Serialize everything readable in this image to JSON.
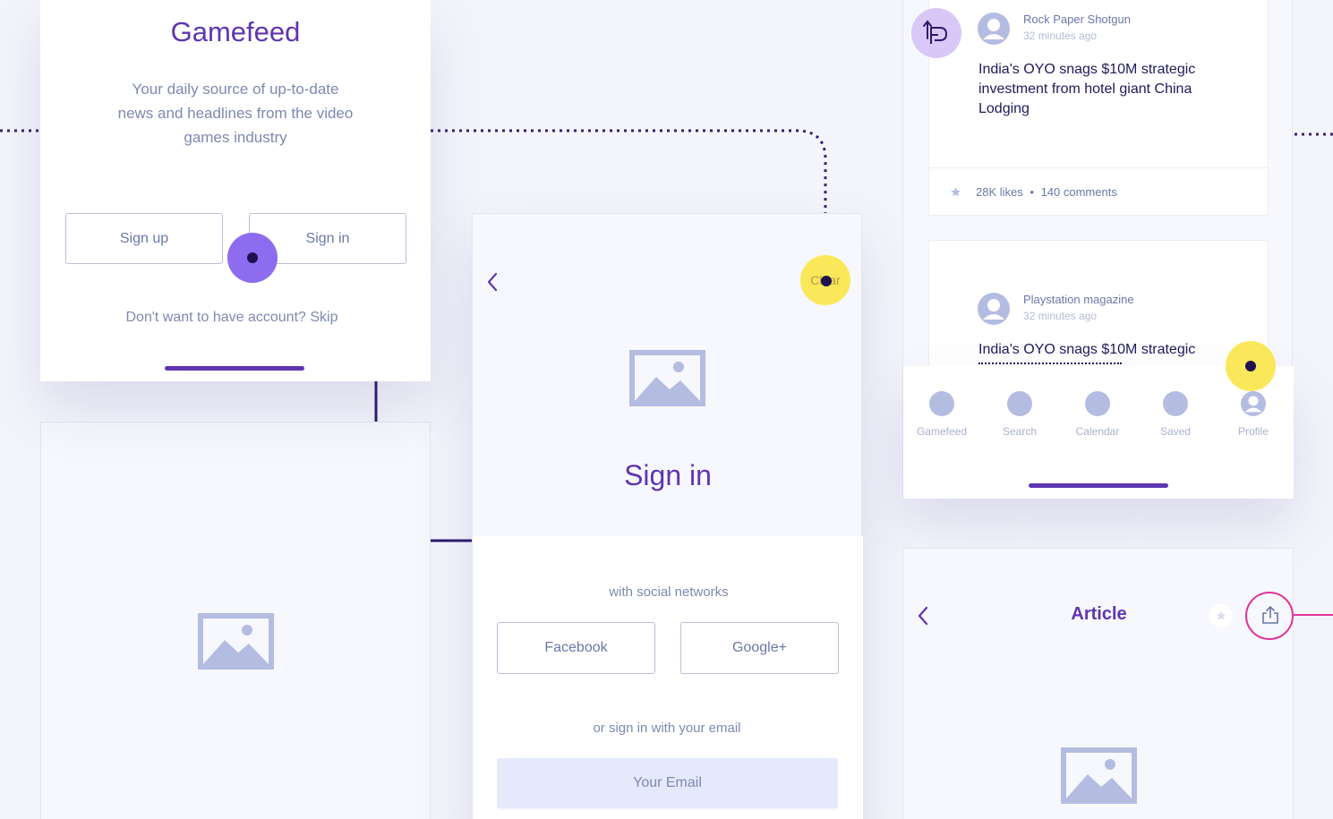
{
  "welcome": {
    "app_title": "Gamefeed",
    "tagline_line1": "Your daily source of up-to-date",
    "tagline_line2": "news and headlines from the video",
    "tagline_line3": "games industry",
    "signup_label": "Sign up",
    "signin_label": "Sign in",
    "skip_text": "Don't want to have account? Skip"
  },
  "signin": {
    "clear_label": "Clear",
    "title": "Sign in",
    "social_caption": "with social networks",
    "facebook_label": "Facebook",
    "google_label": "Google+",
    "email_caption": "or sign in with your email",
    "email_placeholder": "Your Email"
  },
  "feed": {
    "posts": [
      {
        "source": "Rock Paper Shotgun",
        "time": "32 minutes ago",
        "headline_line1": "India's OYO snags $10M strategic",
        "headline_line2": "investment from hotel giant China",
        "headline_line3": "Lodging",
        "likes": "28K likes",
        "separator": "•",
        "comments": "140 comments"
      },
      {
        "source": "Playstation magazine",
        "time": "32 minutes ago",
        "headline_line1": "India's OYO snags $10M strategic"
      }
    ],
    "nav": [
      "Gamefeed",
      "Search",
      "Calendar",
      "Saved",
      "Profile"
    ]
  },
  "article": {
    "title": "Article"
  },
  "colors": {
    "brand_purple": "#5e35b1",
    "accent_violet": "#8e6cf0",
    "hotspot_yellow": "#fbe85a",
    "share_pink": "#e0349c",
    "placeholder": "#b4bce2"
  },
  "icons": [
    "chevron-left-icon",
    "image-placeholder-icon",
    "avatar-icon",
    "star-icon",
    "share-icon",
    "swipe-gesture-icon"
  ]
}
